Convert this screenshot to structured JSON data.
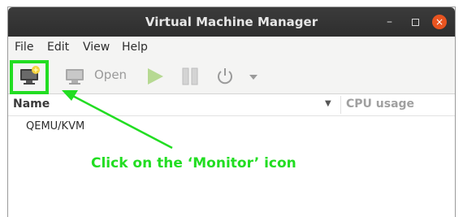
{
  "window": {
    "title": "Virtual Machine Manager"
  },
  "window_controls": {
    "minimize": "–",
    "close": "×"
  },
  "menubar": {
    "items": [
      "File",
      "Edit",
      "View",
      "Help"
    ]
  },
  "toolbar": {
    "open_label": "Open"
  },
  "columns": {
    "name": "Name",
    "cpu": "CPU usage"
  },
  "connections": [
    "QEMU/KVM"
  ],
  "annotation": {
    "text": "Click on the ‘Monitor’ icon",
    "color": "#22dd22"
  },
  "colors": {
    "titlebar": "#2e2e2e",
    "close_button": "#e95420",
    "highlight": "#22dd22"
  }
}
